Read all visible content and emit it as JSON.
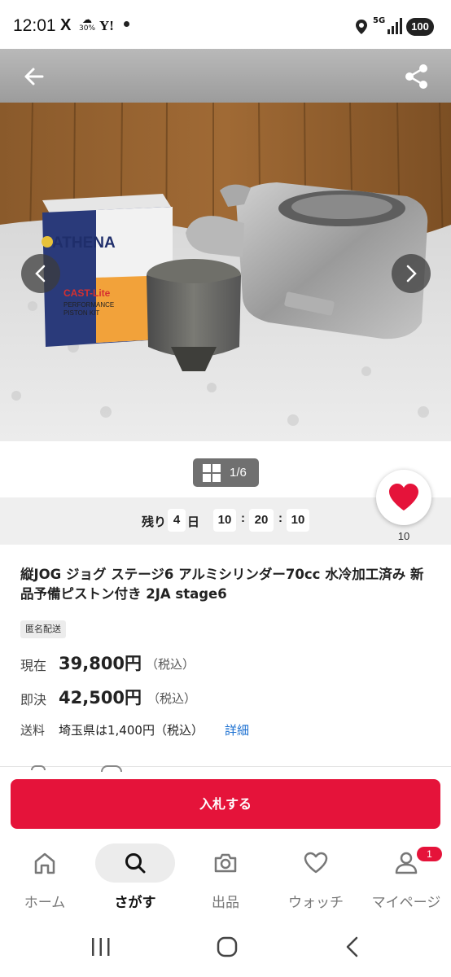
{
  "status_bar": {
    "time": "12:01",
    "x_icon": "X",
    "weather": "30%",
    "yahoo_icon": "Y!",
    "network": "5G",
    "battery": "100"
  },
  "header": {
    "back_icon": "arrow-left-icon",
    "share_icon": "share-icon"
  },
  "gallery": {
    "counter": "1/6"
  },
  "countdown": {
    "remaining_label": "残り",
    "days": "4",
    "days_unit": "日",
    "hours": "10",
    "minutes": "20",
    "seconds": "10",
    "separator": ":"
  },
  "watch": {
    "count": "10",
    "color": "#e5133a"
  },
  "item": {
    "title": "縦JOG ジョグ ステージ6 アルミシリンダー70cc 水冷加工済み 新品予備ピストン付き 2JA stage6",
    "badge": "匿名配送",
    "current_label": "現在",
    "current_price": "39,800円",
    "current_tax": "（税込）",
    "buyout_label": "即決",
    "buyout_price": "42,500円",
    "buyout_tax": "（税込）",
    "shipping_label": "送料",
    "shipping_value": "埼玉県は1,400円（税込）",
    "shipping_detail": "詳細"
  },
  "bid_button": {
    "label": "入札する",
    "color": "#e5133a"
  },
  "bottom_nav": {
    "items": [
      {
        "label": "ホーム",
        "icon": "home-icon"
      },
      {
        "label": "さがす",
        "icon": "search-icon"
      },
      {
        "label": "出品",
        "icon": "camera-icon"
      },
      {
        "label": "ウォッチ",
        "icon": "heart-icon"
      },
      {
        "label": "マイページ",
        "icon": "person-icon"
      }
    ],
    "badge": "1"
  }
}
